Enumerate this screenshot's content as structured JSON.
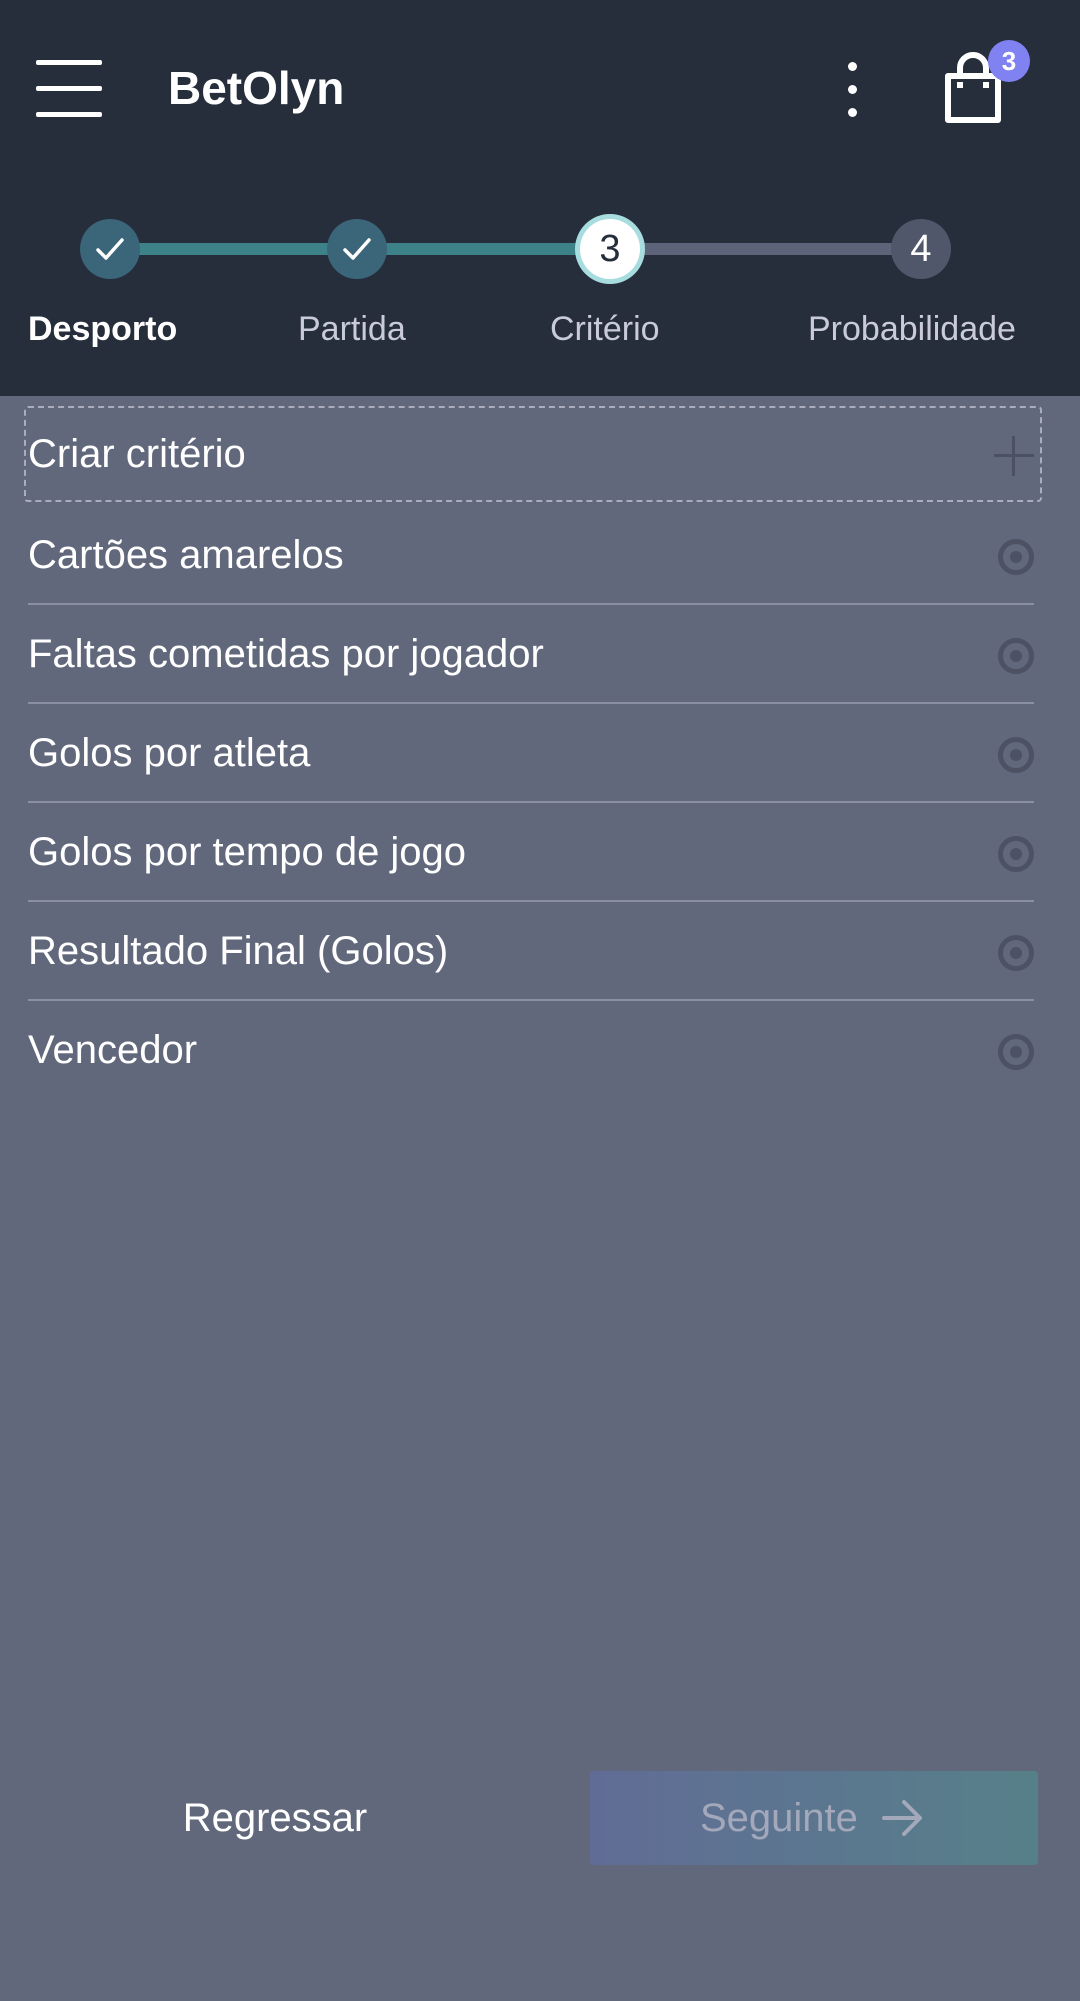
{
  "app": {
    "title": "BetOlyn",
    "cart_count": "3"
  },
  "stepper": {
    "steps": [
      {
        "label": "Desporto",
        "number": "",
        "status": "done"
      },
      {
        "label": "Partida",
        "number": "",
        "status": "done"
      },
      {
        "label": "Critério",
        "number": "3",
        "status": "active"
      },
      {
        "label": "Probabilidade",
        "number": "4",
        "status": "todo"
      }
    ],
    "current_label": "Desporto"
  },
  "criteria": {
    "create_label": "Criar critério",
    "options": [
      {
        "label": "Cartões amarelos"
      },
      {
        "label": "Faltas cometidas por jogador"
      },
      {
        "label": "Golos por atleta"
      },
      {
        "label": "Golos por tempo de jogo"
      },
      {
        "label": "Resultado Final (Golos)"
      },
      {
        "label": "Vencedor"
      }
    ]
  },
  "footer": {
    "back_label": "Regressar",
    "next_label": "Seguinte"
  },
  "icons": [
    "menu-icon",
    "more-vert-icon",
    "shopping-bag-icon",
    "check-icon",
    "plus-icon",
    "radio-icon",
    "arrow-right-icon"
  ],
  "colors": {
    "header_bg": "#262d3b",
    "body_bg": "#62687c",
    "progress_done": "#3d8288",
    "badge": "#7f82f0"
  }
}
